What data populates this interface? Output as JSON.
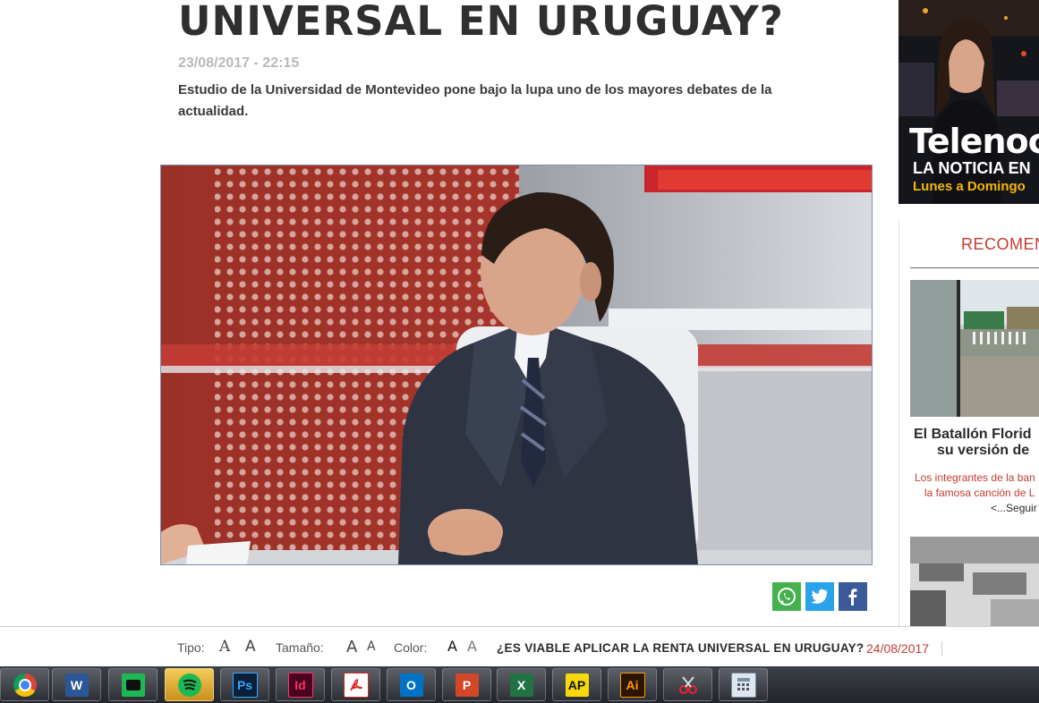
{
  "article": {
    "title": "UNIVERSAL EN URUGUAY?",
    "date": "23/08/2017 - 22:15",
    "subtitle": "Estudio de la Universidad de Montevideo pone bajo la lupa uno de los mayores debates de la actualidad."
  },
  "share": {
    "whatsapp_icon": "whatsapp-icon",
    "twitter_icon": "twitter-icon",
    "facebook_icon": "facebook-icon"
  },
  "sidebar": {
    "ad": {
      "brand": "Telenoc",
      "line1": "LA NOTICIA EN",
      "line2": "Lunes a Domingo"
    },
    "recommended": {
      "title": "RECOMEN",
      "item_headline_1": "El Batallón Florid",
      "item_headline_2": "su versión de",
      "item_excerpt_1": "Los integrantes de la ban",
      "item_excerpt_2": "la famosa canción de L",
      "item_more": "<...Seguir l"
    }
  },
  "toolbar": {
    "tipo_label": "Tipo:",
    "tipo_a1": "A",
    "tipo_a2": "A",
    "tamano_label": "Tamaño:",
    "tamano_a1": "A",
    "tamano_a2": "A",
    "color_label": "Color:",
    "color_a1": "A",
    "color_a2": "A",
    "headline": "¿ES VIABLE APLICAR LA RENTA UNIVERSAL EN URUGUAY?",
    "date": "24/08/2017"
  },
  "taskbar": {
    "apps": [
      {
        "name": "chrome-icon",
        "label": ""
      },
      {
        "name": "word-icon",
        "label": "W"
      },
      {
        "name": "app-stack-icon",
        "label": ""
      },
      {
        "name": "spotify-icon",
        "label": ""
      },
      {
        "name": "photoshop-icon",
        "label": "Ps"
      },
      {
        "name": "indesign-icon",
        "label": "Id"
      },
      {
        "name": "acrobat-icon",
        "label": ""
      },
      {
        "name": "outlook-icon",
        "label": "O"
      },
      {
        "name": "powerpoint-icon",
        "label": "P"
      },
      {
        "name": "excel-icon",
        "label": "X"
      },
      {
        "name": "ap-icon",
        "label": "AP"
      },
      {
        "name": "illustrator-icon",
        "label": "Ai"
      },
      {
        "name": "snipping-tool-icon",
        "label": ""
      },
      {
        "name": "calculator-icon",
        "label": ""
      }
    ]
  },
  "colors": {
    "accent_red": "#c63a32",
    "whatsapp": "#43b14c",
    "twitter": "#2aa3ea",
    "facebook": "#3b5a9a"
  }
}
